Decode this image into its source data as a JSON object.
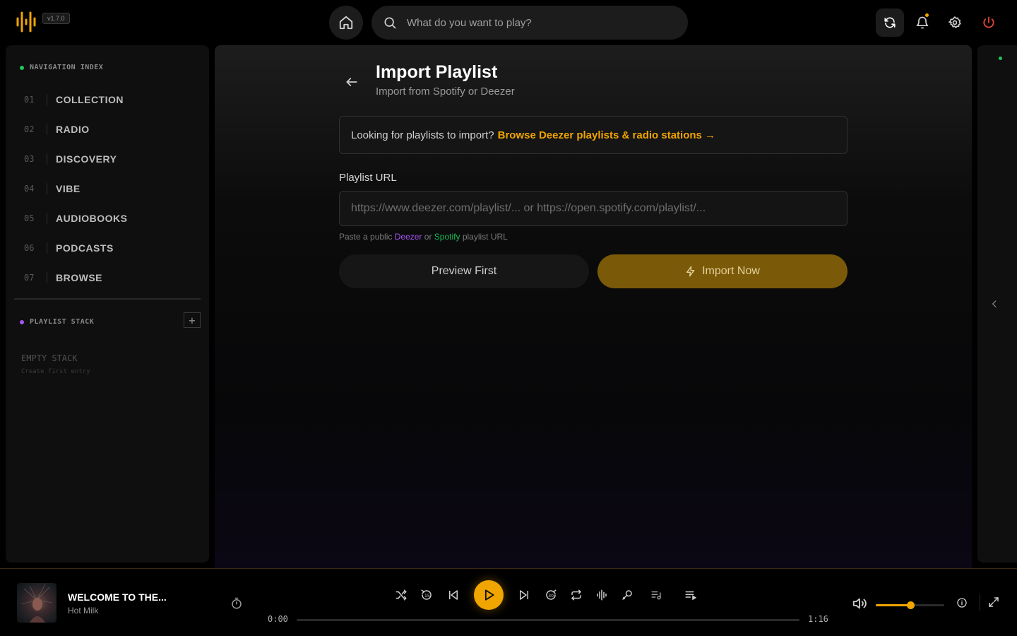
{
  "app": {
    "version": "v1.7.0",
    "colors": {
      "accent": "#f0a500",
      "deezer": "#a855f7",
      "spotify": "#1db954",
      "power": "#e0443a",
      "nav_dot": "#22c55e",
      "stack_dot": "#a855f7"
    }
  },
  "header": {
    "search_placeholder": "What do you want to play?",
    "icons": [
      "home-icon",
      "search-icon",
      "sync-icon",
      "bell-icon",
      "gear-icon",
      "power-icon"
    ]
  },
  "sidebar": {
    "nav_title": "NAVIGATION INDEX",
    "items": [
      {
        "num": "01",
        "label": "COLLECTION"
      },
      {
        "num": "02",
        "label": "RADIO"
      },
      {
        "num": "03",
        "label": "DISCOVERY"
      },
      {
        "num": "04",
        "label": "VIBE"
      },
      {
        "num": "05",
        "label": "AUDIOBOOKS"
      },
      {
        "num": "06",
        "label": "PODCASTS"
      },
      {
        "num": "07",
        "label": "BROWSE"
      }
    ],
    "playlist_title": "PLAYLIST STACK",
    "add_label": "+",
    "empty_title": "EMPTY STACK",
    "empty_sub": "Create first entry"
  },
  "main": {
    "title": "Import Playlist",
    "subtitle": "Import from Spotify or Deezer",
    "info_text": "Looking for playlists to import?",
    "info_link": "Browse Deezer playlists & radio stations →",
    "url_label": "Playlist URL",
    "url_placeholder": "https://www.deezer.com/playlist/... or https://open.spotify.com/playlist/...",
    "hint_pre": "Paste a public",
    "hint_deezer": "Deezer",
    "hint_or": "or",
    "hint_spotify": "Spotify",
    "hint_post": "playlist URL",
    "preview_button": "Preview First",
    "import_button": "Import Now"
  },
  "player": {
    "track_title": "WELCOME TO THE...",
    "artist": "Hot Milk",
    "time_current": "0:00",
    "time_total": "1:16",
    "progress": 0.0,
    "volume": 0.5
  }
}
